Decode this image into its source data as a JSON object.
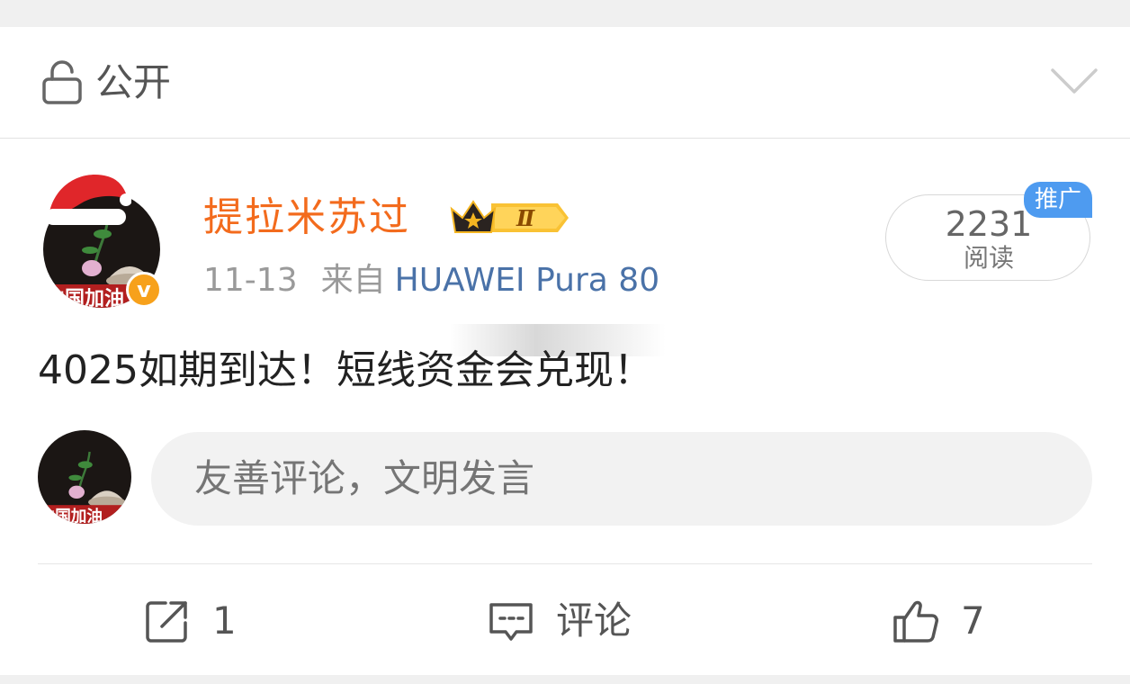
{
  "privacy": {
    "label": "公开"
  },
  "post": {
    "author": "提拉米苏过",
    "vip_level": "Ⅱ",
    "date": "11-13",
    "source_label": "来自",
    "device": "HUAWEI Pura 80",
    "read_count": "2231",
    "read_label": "阅读",
    "promo_tag": "推广",
    "text": "4025如期到达！短线资金会兑现！",
    "avatar_caption": "中国加油"
  },
  "comment_box": {
    "placeholder": "友善评论，文明发言"
  },
  "actions": {
    "repost_count": "1",
    "comment_label": "评论",
    "like_count": "7"
  },
  "colors": {
    "username": "#f36b1d",
    "device_link": "#4a72a8",
    "promo": "#4e9bf0",
    "verified": "#f7a11b"
  }
}
